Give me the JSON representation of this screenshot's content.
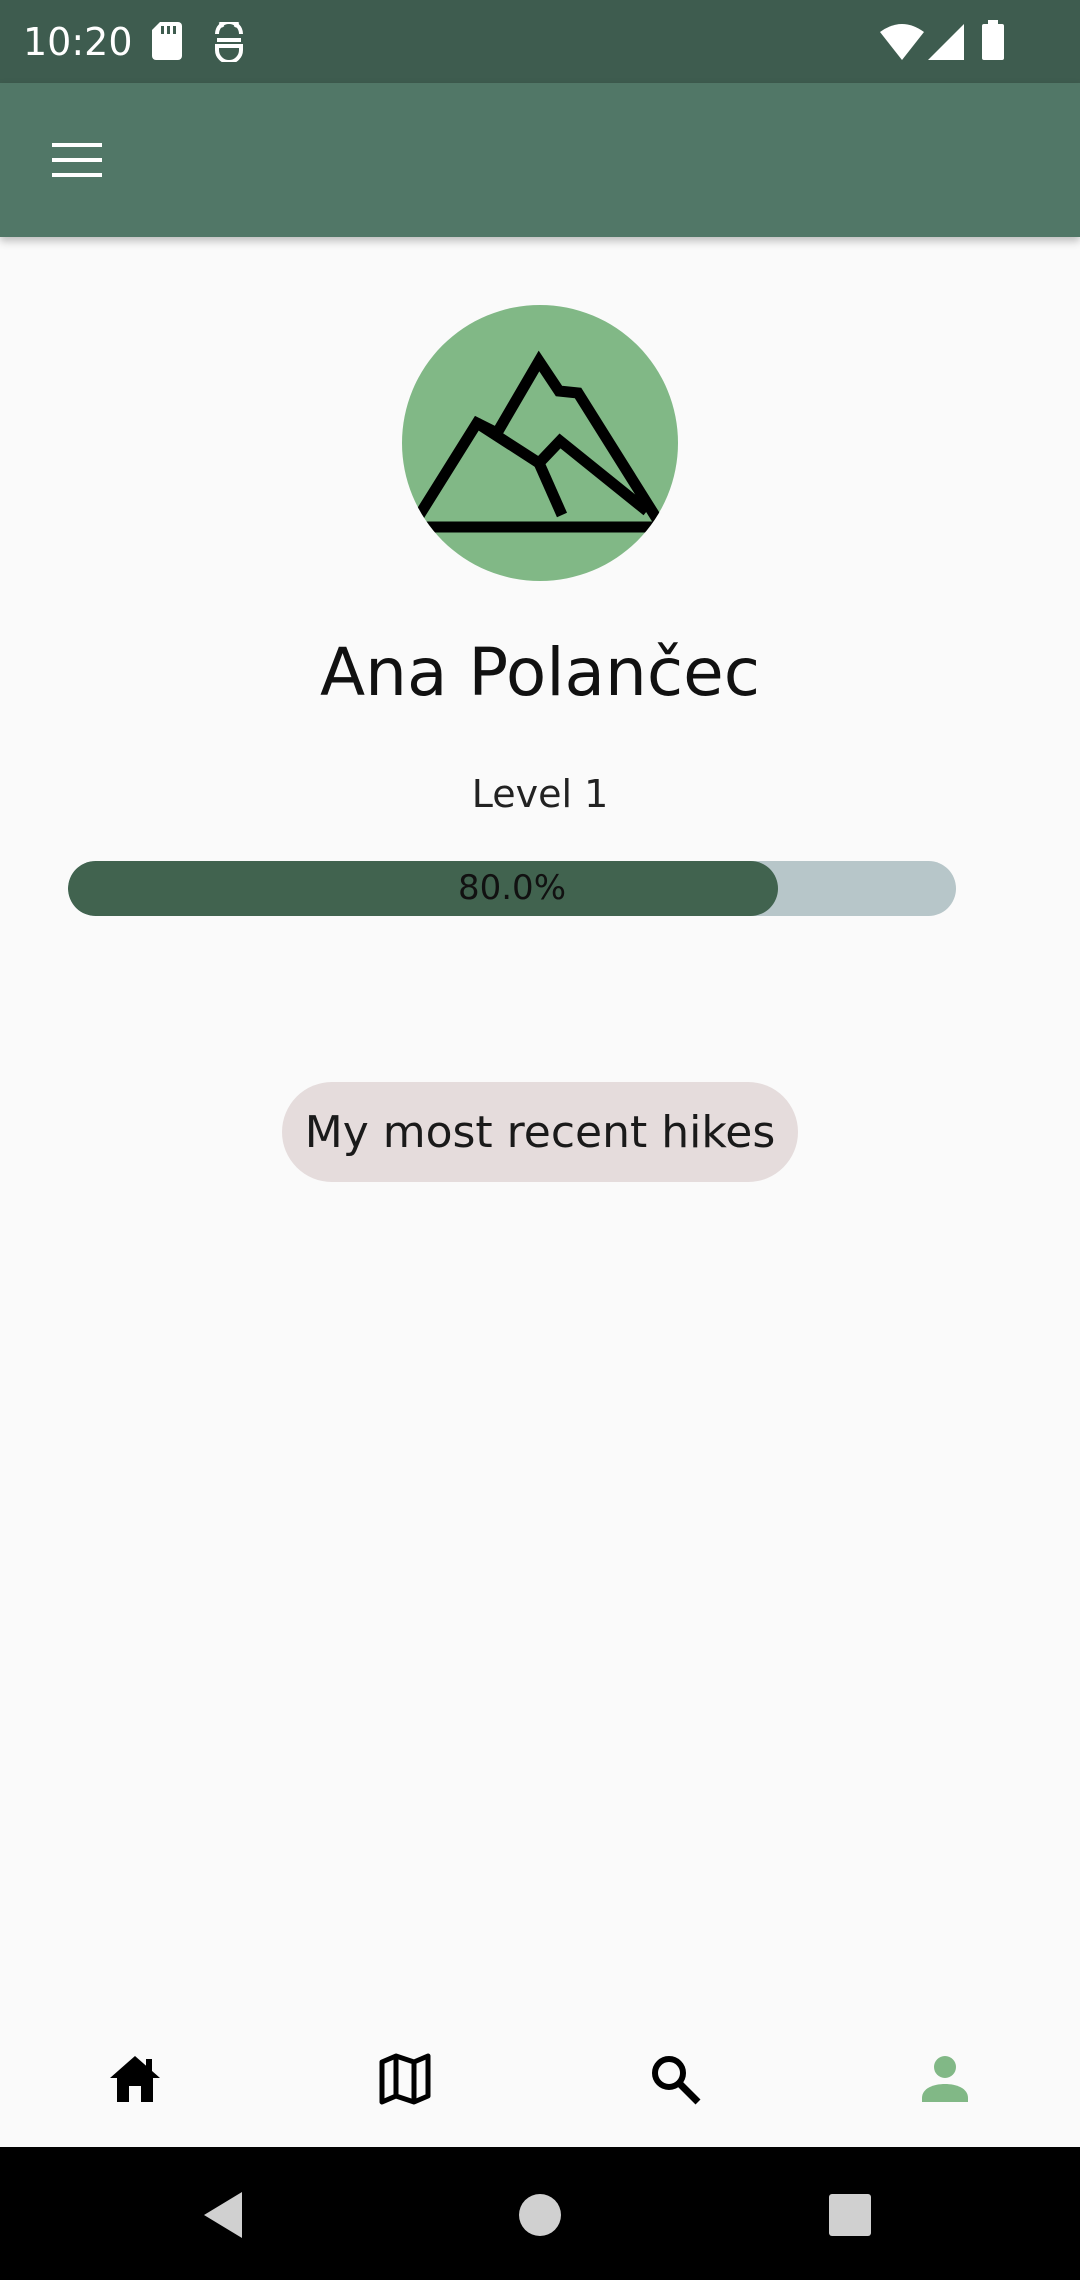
{
  "status_bar": {
    "time": "10:20",
    "icons": [
      "sd-card-icon",
      "android-debug-icon",
      "wifi-icon",
      "signal-icon",
      "battery-icon"
    ]
  },
  "app_bar": {
    "menu_icon": "menu-icon"
  },
  "profile": {
    "avatar_icon": "mountain-icon",
    "name": "Ana Polančec",
    "level": "Level 1",
    "progress": {
      "value": 0.8,
      "label": "80.0%"
    }
  },
  "actions": {
    "recent_hikes_label": "My most recent hikes"
  },
  "bottom_nav": {
    "items": [
      {
        "icon": "home-icon",
        "active": false
      },
      {
        "icon": "map-icon",
        "active": false
      },
      {
        "icon": "search-icon",
        "active": false
      },
      {
        "icon": "person-icon",
        "active": true
      }
    ]
  },
  "system_nav": {
    "icons": [
      "back-icon",
      "home-circle-icon",
      "recents-icon"
    ]
  },
  "colors": {
    "status_bar": "#3e5c4f",
    "app_bar": "#517767",
    "avatar_bg": "#81b886",
    "progress_fill": "#41634f",
    "progress_track": "#b7c6c9",
    "button_bg": "#e5dcdc",
    "nav_active": "#81b886"
  }
}
